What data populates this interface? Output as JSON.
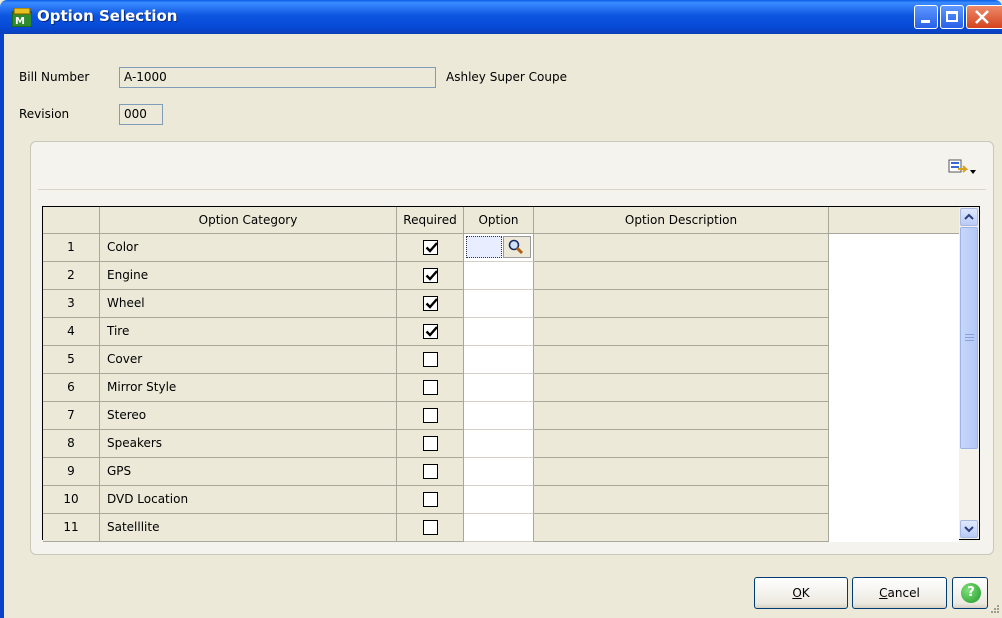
{
  "window": {
    "title": "Option Selection"
  },
  "form": {
    "bill_number_label": "Bill Number",
    "bill_number_value": "A-1000",
    "bill_description": "Ashley Super Coupe",
    "revision_label": "Revision",
    "revision_value": "000"
  },
  "grid": {
    "columns": [
      "Option Category",
      "Required",
      "Option",
      "Option Description"
    ],
    "rows": [
      {
        "num": "1",
        "category": "Color",
        "required": true
      },
      {
        "num": "2",
        "category": "Engine",
        "required": true
      },
      {
        "num": "3",
        "category": "Wheel",
        "required": true
      },
      {
        "num": "4",
        "category": "Tire",
        "required": true
      },
      {
        "num": "5",
        "category": "Cover",
        "required": false
      },
      {
        "num": "6",
        "category": "Mirror Style",
        "required": false
      },
      {
        "num": "7",
        "category": "Stereo",
        "required": false
      },
      {
        "num": "8",
        "category": "Speakers",
        "required": false
      },
      {
        "num": "9",
        "category": "GPS",
        "required": false
      },
      {
        "num": "10",
        "category": "DVD Location",
        "required": false
      },
      {
        "num": "11",
        "category": "Satelllite",
        "required": false
      }
    ]
  },
  "buttons": {
    "ok": "OK",
    "cancel": "Cancel",
    "help": "?"
  },
  "colors": {
    "titlebar": "#0a5ce8",
    "face": "#ece9d8",
    "scroll": "#b8caf5"
  }
}
